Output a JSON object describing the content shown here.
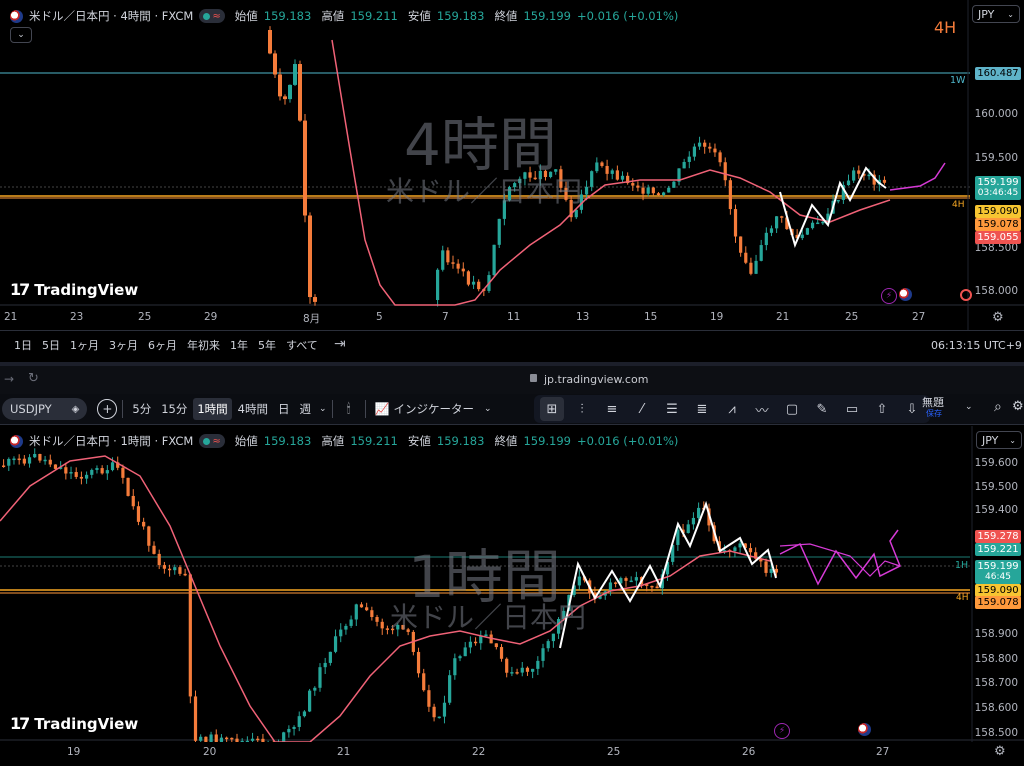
{
  "pane_top": {
    "symbol_label": "米ドル／日本円 · 4時間 · FXCM",
    "ohlc": {
      "open_label": "始値",
      "open": "159.183",
      "high_label": "高値",
      "high": "159.211",
      "low_label": "安値",
      "low": "159.183",
      "close_label": "終値",
      "close": "159.199",
      "change": "+0.016 (+0.01%)"
    },
    "currency": "JPY",
    "timeframe_badge": "4H",
    "watermark_big": "4時間",
    "watermark_small": "米ドル／日本円",
    "brand": "TradingView",
    "y_labels": [
      "160.000",
      "159.500",
      "158.500",
      "158.000"
    ],
    "price_tags": [
      {
        "text": "160.487",
        "color": "#5fb3c9"
      },
      {
        "text": "159.199",
        "color": "#26a69a",
        "sub": "03:46:45"
      },
      {
        "text": "159.090",
        "color": "#f7c531"
      },
      {
        "text": "159.078",
        "color": "#ff9a3c"
      },
      {
        "text": "159.055",
        "color": "#ef5350"
      }
    ],
    "line_tag_1w": "1W",
    "line_tag_4h": "4H",
    "x_labels": [
      "21",
      "23",
      "25",
      "29",
      "8月",
      "5",
      "7",
      "11",
      "13",
      "15",
      "19",
      "21",
      "25",
      "27"
    ],
    "range_buttons": [
      "1日",
      "5日",
      "1ヶ月",
      "3ヶ月",
      "6ヶ月",
      "年初来",
      "1年",
      "5年",
      "すべて"
    ],
    "clock": "06:13:15 UTC+9",
    "colors": {
      "up": "#26a69a",
      "down": "#f57c3b",
      "ma": "#f06277",
      "hline": "#4fb7cc",
      "support": "#f5a623"
    }
  },
  "browser": {
    "url": "jp.tradingview.com"
  },
  "toolbar": {
    "symbol": "USDJPY",
    "intervals": [
      "5分",
      "15分",
      "1時間",
      "4時間",
      "日",
      "週"
    ],
    "active_interval": "1時間",
    "indicators": "インジケーター",
    "layout_name": "無題",
    "layout_sub": "保存"
  },
  "pane_bottom": {
    "symbol_label": "米ドル／日本円 · 1時間 · FXCM",
    "ohlc": {
      "open_label": "始値",
      "open": "159.183",
      "high_label": "高値",
      "high": "159.211",
      "low_label": "安値",
      "low": "159.183",
      "close_label": "終値",
      "close": "159.199",
      "change": "+0.016 (+0.01%)"
    },
    "currency": "JPY",
    "watermark_big": "1時間",
    "watermark_small": "米ドル／日本円",
    "brand": "TradingView",
    "y_labels": [
      "159.600",
      "159.500",
      "159.400",
      "158.900",
      "158.800",
      "158.700",
      "158.600",
      "158.500"
    ],
    "price_tags": [
      {
        "text": "159.278",
        "color": "#ef5350"
      },
      {
        "text": "159.221",
        "color": "#26a69a"
      },
      {
        "text": "159.199",
        "color": "#26a69a",
        "sub": "46:45"
      },
      {
        "text": "159.090",
        "color": "#f7c531"
      },
      {
        "text": "159.078",
        "color": "#ff9a3c"
      }
    ],
    "line_tag_1h": "1H",
    "line_tag_4h": "4H",
    "x_labels": [
      "19",
      "20",
      "21",
      "22",
      "25",
      "26",
      "27"
    ]
  }
}
